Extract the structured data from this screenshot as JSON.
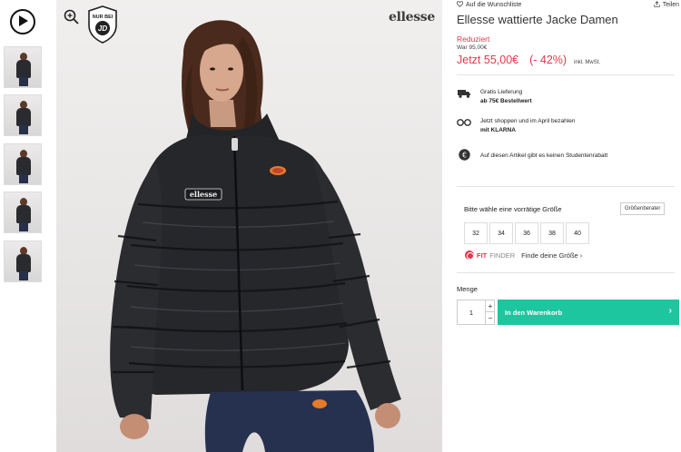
{
  "thumbnails": {
    "count": 5
  },
  "image": {
    "brand_logo": "ellesse",
    "badge_line1": "NUR BEI",
    "badge_line2": "JD",
    "chest_label": "ellesse"
  },
  "product": {
    "wishlist_label": "Auf die Wunschliste",
    "share_label": "Teilen",
    "title": "Ellesse wattierte Jacke Damen",
    "reduced_label": "Reduziert",
    "was_price": "War 95,00€",
    "price": "Jetzt 55,00€",
    "discount": "(- 42%)",
    "vat": "inkl. MwSt."
  },
  "info": {
    "delivery_line1": "Gratis Lieferung",
    "delivery_line2": "ab 75€ Bestellwert",
    "klarna_line1": "Jetzt shoppen und im April bezahlen",
    "klarna_line2": "mit KLARNA",
    "student_line": "Auf diesen Artikel gibt es keinen Studentenrabatt"
  },
  "sizes": {
    "label": "Bitte wähle eine vorrätige Größe",
    "guide_label": "Größenberater",
    "options": [
      "32",
      "34",
      "36",
      "38",
      "40"
    ],
    "fitfinder_fit": "FIT",
    "fitfinder_finder": "FINDER",
    "fitfinder_link": "Finde deine Größe ›"
  },
  "quantity": {
    "label": "Menge",
    "value": "1",
    "plus": "+",
    "minus": "−"
  },
  "cart": {
    "button_label": "In den Warenkorb",
    "chevron": "›"
  },
  "colors": {
    "sale_red": "#e2384d",
    "cart_green": "#1ec6a0"
  }
}
